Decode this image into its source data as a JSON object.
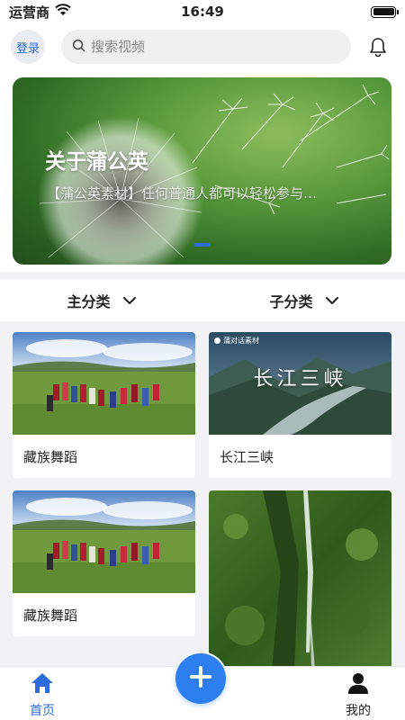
{
  "status_bar": {
    "carrier": "运营商",
    "time": "16:49"
  },
  "header": {
    "login_label": "登录",
    "search_placeholder": "搜索视频",
    "icons": [
      "search-icon",
      "bell-icon"
    ]
  },
  "banner": {
    "title": "关于蒲公英",
    "subtitle": "【蒲公英素材】任何普通人都可以轻松参与…",
    "active_slide": 1
  },
  "categories": {
    "main_label": "主分类",
    "sub_label": "子分类"
  },
  "videos": [
    {
      "title": "藏族舞蹈",
      "thumb": "tibetan-dance"
    },
    {
      "title": "长江三峡",
      "thumb": "three-gorges",
      "overlay_big": "长江三峡",
      "overlay_brand": "蒲对话素材"
    },
    {
      "title": "藏族舞蹈",
      "thumb": "tibetan-dance"
    },
    {
      "title": "",
      "thumb": "waterfall-cliff"
    }
  ],
  "tab_bar": {
    "home_label": "首页",
    "mine_label": "我的",
    "active": "home"
  },
  "colors": {
    "accent": "#2d7ff0",
    "tab_active": "#2d6cdf",
    "background": "#f2f2f4"
  }
}
